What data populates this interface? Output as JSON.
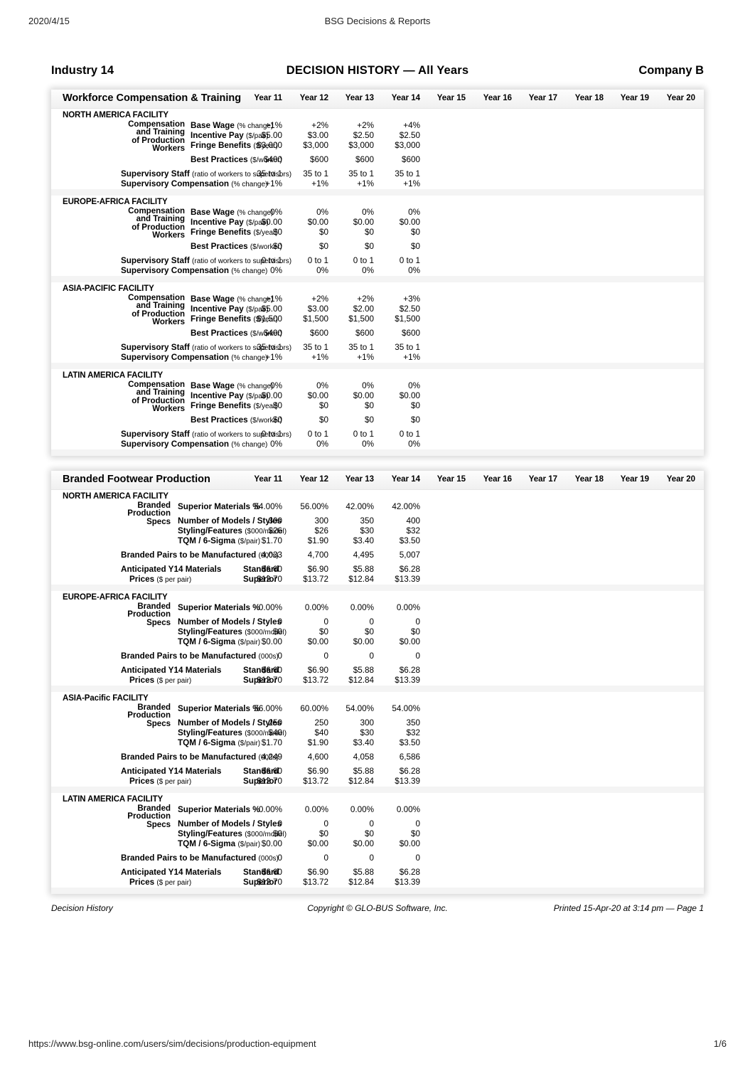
{
  "browser": {
    "date": "2020/4/15",
    "doc_title": "BSG Decisions & Reports",
    "url": "https://www.bsg-online.com/users/sim/decisions/production-equipment",
    "page_indicator": "1/6"
  },
  "title_band": {
    "industry": "Industry 14",
    "main_title": "DECISION  HISTORY — All Years",
    "company": "Company B"
  },
  "years": [
    "Year 11",
    "Year 12",
    "Year 13",
    "Year 14",
    "Year 15",
    "Year 16",
    "Year 17",
    "Year 18",
    "Year 19",
    "Year 20"
  ],
  "report_footer": {
    "left": "Decision History",
    "center": "Copyright © GLO-BUS Software, Inc.",
    "right": "Printed 15-Apr-20 at 3:14 pm — Page 1"
  },
  "workforce": {
    "panel_title": "Workforce Compensation & Training",
    "group_label": "Compensation\nand Training\nof Production\nWorkers",
    "group_label_lines": [
      "Compensation",
      "and Training",
      "of Production",
      "Workers"
    ],
    "rows": [
      {
        "label": "Base Wage",
        "unit": "(% change)"
      },
      {
        "label": "Incentive Pay",
        "unit": "($/pair)"
      },
      {
        "label": "Fringe Benefits",
        "unit": "($/year)"
      },
      {
        "label": "Best Practices",
        "unit": "($/worker)"
      }
    ],
    "supervisory_staff": {
      "label": "Supervisory Staff",
      "unit": "(ratio of workers to supervisors)"
    },
    "supervisory_comp": {
      "label": "Supervisory Compensation",
      "unit": "(% change)"
    },
    "facilities": [
      {
        "name": "NORTH AMERICA FACILITY",
        "base_wage": [
          "+1%",
          "+2%",
          "+2%",
          "+4%"
        ],
        "incentive_pay": [
          "$5.00",
          "$3.00",
          "$2.50",
          "$2.50"
        ],
        "fringe_benefits": [
          "$3,000",
          "$3,000",
          "$3,000",
          "$3,000"
        ],
        "best_practices": [
          "$400",
          "$600",
          "$600",
          "$600"
        ],
        "supervisory_staff": [
          "35 to 1",
          "35 to 1",
          "35 to 1",
          "35 to 1"
        ],
        "supervisory_comp": [
          "+1%",
          "+1%",
          "+1%",
          "+1%"
        ]
      },
      {
        "name": "EUROPE-AFRICA FACILITY",
        "base_wage": [
          "0%",
          "0%",
          "0%",
          "0%"
        ],
        "incentive_pay": [
          "$0.00",
          "$0.00",
          "$0.00",
          "$0.00"
        ],
        "fringe_benefits": [
          "$0",
          "$0",
          "$0",
          "$0"
        ],
        "best_practices": [
          "$0",
          "$0",
          "$0",
          "$0"
        ],
        "supervisory_staff": [
          "0 to 1",
          "0 to 1",
          "0 to 1",
          "0 to 1"
        ],
        "supervisory_comp": [
          "0%",
          "0%",
          "0%",
          "0%"
        ]
      },
      {
        "name": "ASIA-PACIFIC FACILITY",
        "base_wage": [
          "+1%",
          "+2%",
          "+2%",
          "+3%"
        ],
        "incentive_pay": [
          "$5.00",
          "$3.00",
          "$2.00",
          "$2.50"
        ],
        "fringe_benefits": [
          "$1,500",
          "$1,500",
          "$1,500",
          "$1,500"
        ],
        "best_practices": [
          "$400",
          "$600",
          "$600",
          "$600"
        ],
        "supervisory_staff": [
          "35 to 1",
          "35 to 1",
          "35 to 1",
          "35 to 1"
        ],
        "supervisory_comp": [
          "+1%",
          "+1%",
          "+1%",
          "+1%"
        ]
      },
      {
        "name": "LATIN AMERICA FACILITY",
        "base_wage": [
          "0%",
          "0%",
          "0%",
          "0%"
        ],
        "incentive_pay": [
          "$0.00",
          "$0.00",
          "$0.00",
          "$0.00"
        ],
        "fringe_benefits": [
          "$0",
          "$0",
          "$0",
          "$0"
        ],
        "best_practices": [
          "$0",
          "$0",
          "$0",
          "$0"
        ],
        "supervisory_staff": [
          "0 to 1",
          "0 to 1",
          "0 to 1",
          "0 to 1"
        ],
        "supervisory_comp": [
          "0%",
          "0%",
          "0%",
          "0%"
        ]
      }
    ]
  },
  "branded": {
    "panel_title": "Branded Footwear Production",
    "group_label_lines": [
      "Branded",
      "Production",
      "Specs"
    ],
    "rows": [
      {
        "label": "Superior Materials %",
        "unit": ""
      },
      {
        "label": "Number of Models / Styles",
        "unit": ""
      },
      {
        "label": "Styling/Features",
        "unit": "($000/model)"
      },
      {
        "label": "TQM / 6-Sigma",
        "unit": "($/pair)"
      }
    ],
    "pairs_row": {
      "label": "Branded Pairs to be Manufactured",
      "unit": "(000s)"
    },
    "prices_label_lines": [
      "Anticipated Y14 Materials",
      "Prices"
    ],
    "prices_unit": "($ per pair)",
    "price_sub_standard": "Standard",
    "price_sub_superior": "Superior",
    "facilities": [
      {
        "name": "NORTH AMERICA FACILITY",
        "superior_materials": [
          "54.00%",
          "56.00%",
          "42.00%",
          "42.00%"
        ],
        "models_styles": [
          "300",
          "300",
          "350",
          "400"
        ],
        "styling_features": [
          "$26",
          "$26",
          "$30",
          "$32"
        ],
        "tqm_sigma": [
          "$1.70",
          "$1.90",
          "$3.40",
          "$3.50"
        ],
        "pairs": [
          "4,033",
          "4,700",
          "4,495",
          "5,007"
        ],
        "price_standard": [
          "$6.60",
          "$6.90",
          "$5.88",
          "$6.28"
        ],
        "price_superior": [
          "$12.70",
          "$13.72",
          "$12.84",
          "$13.39"
        ]
      },
      {
        "name": "EUROPE-AFRICA FACILITY",
        "superior_materials": [
          "0.00%",
          "0.00%",
          "0.00%",
          "0.00%"
        ],
        "models_styles": [
          "0",
          "0",
          "0",
          "0"
        ],
        "styling_features": [
          "$0",
          "$0",
          "$0",
          "$0"
        ],
        "tqm_sigma": [
          "$0.00",
          "$0.00",
          "$0.00",
          "$0.00"
        ],
        "pairs": [
          "0",
          "0",
          "0",
          "0"
        ],
        "price_standard": [
          "$6.60",
          "$6.90",
          "$5.88",
          "$6.28"
        ],
        "price_superior": [
          "$12.70",
          "$13.72",
          "$12.84",
          "$13.39"
        ]
      },
      {
        "name": "ASIA-Pacific FACILITY",
        "superior_materials": [
          "56.00%",
          "60.00%",
          "54.00%",
          "54.00%"
        ],
        "models_styles": [
          "250",
          "250",
          "300",
          "350"
        ],
        "styling_features": [
          "$40",
          "$40",
          "$30",
          "$32"
        ],
        "tqm_sigma": [
          "$1.70",
          "$1.90",
          "$3.40",
          "$3.50"
        ],
        "pairs": [
          "4,249",
          "4,600",
          "4,058",
          "6,586"
        ],
        "price_standard": [
          "$6.60",
          "$6.90",
          "$5.88",
          "$6.28"
        ],
        "price_superior": [
          "$12.70",
          "$13.72",
          "$12.84",
          "$13.39"
        ]
      },
      {
        "name": "LATIN AMERICA FACILITY",
        "superior_materials": [
          "0.00%",
          "0.00%",
          "0.00%",
          "0.00%"
        ],
        "models_styles": [
          "0",
          "0",
          "0",
          "0"
        ],
        "styling_features": [
          "$0",
          "$0",
          "$0",
          "$0"
        ],
        "tqm_sigma": [
          "$0.00",
          "$0.00",
          "$0.00",
          "$0.00"
        ],
        "pairs": [
          "0",
          "0",
          "0",
          "0"
        ],
        "price_standard": [
          "$6.60",
          "$6.90",
          "$5.88",
          "$6.28"
        ],
        "price_superior": [
          "$12.70",
          "$13.72",
          "$12.84",
          "$13.39"
        ]
      }
    ]
  }
}
